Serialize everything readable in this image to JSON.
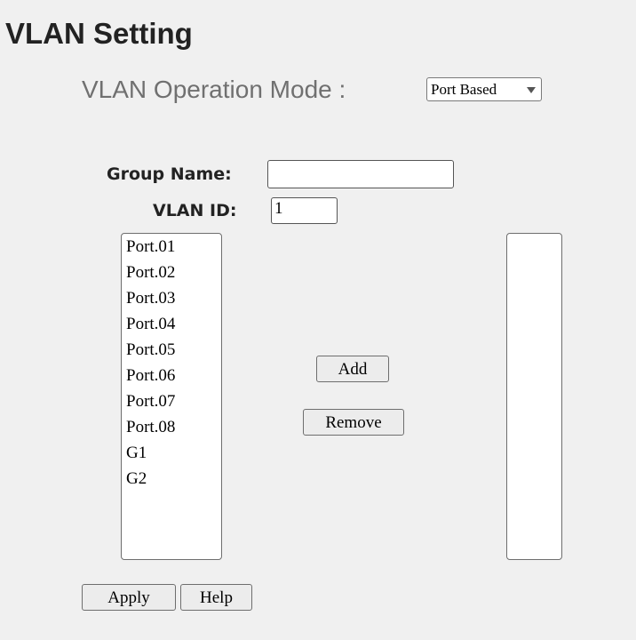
{
  "page": {
    "title": "VLAN Setting"
  },
  "operation_mode": {
    "label": "VLAN Operation Mode :",
    "selected": "Port Based"
  },
  "group_name": {
    "label": "Group Name:",
    "value": ""
  },
  "vlan_id": {
    "label": "VLAN ID:",
    "value": "1"
  },
  "available_ports": {
    "items": [
      "Port.01",
      "Port.02",
      "Port.03",
      "Port.04",
      "Port.05",
      "Port.06",
      "Port.07",
      "Port.08",
      "G1",
      "G2"
    ]
  },
  "member_ports": {
    "items": []
  },
  "buttons": {
    "add": "Add",
    "remove": "Remove",
    "apply": "Apply",
    "help": "Help"
  },
  "icons": {
    "dropdown": "chevron-down-icon"
  }
}
